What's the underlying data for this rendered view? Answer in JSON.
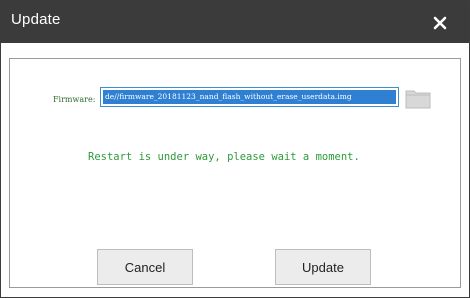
{
  "dialog": {
    "title": "Update",
    "close_icon": "close-icon"
  },
  "firmware": {
    "label": "Firmware:",
    "value": "de//firmware_20181123_nand_flash_without_erase_userdata.img",
    "folder_icon": "folder-icon"
  },
  "status": {
    "message": "Restart is under way, please wait a moment."
  },
  "buttons": {
    "cancel_label": "Cancel",
    "update_label": "Update"
  },
  "colors": {
    "titlebar": "#3b3b3b",
    "status_text": "#2e9a3c",
    "selection": "#2f7fd3"
  }
}
